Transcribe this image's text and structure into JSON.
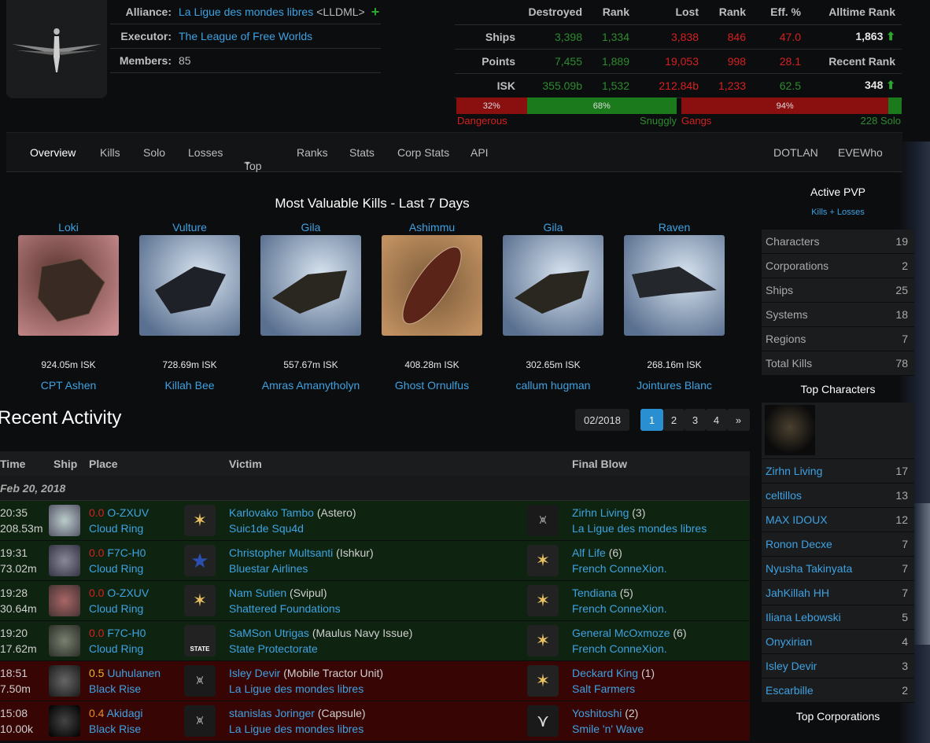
{
  "alliance_info": {
    "alliance_label": "Alliance:",
    "alliance_name": "La Ligue des mondes libres",
    "alliance_ticker": "<LLDML>",
    "executor_label": "Executor:",
    "executor_name": "The League of Free Worlds",
    "members_label": "Members:",
    "members_value": "85"
  },
  "stats": {
    "headers": [
      "Destroyed",
      "Rank",
      "Lost",
      "Rank",
      "Eff. %",
      "Alltime Rank"
    ],
    "ships": {
      "label": "Ships",
      "destroyed": "3,398",
      "destroyed_rank": "1,334",
      "lost": "3,838",
      "lost_rank": "846",
      "eff": "47.0",
      "extra": "1,863"
    },
    "points": {
      "label": "Points",
      "destroyed": "7,455",
      "destroyed_rank": "1,889",
      "lost": "19,053",
      "lost_rank": "998",
      "eff": "28.1",
      "extra": "Recent Rank"
    },
    "isk": {
      "label": "ISK",
      "destroyed": "355.09b",
      "destroyed_rank": "1,532",
      "lost": "212.84b",
      "lost_rank": "1,233",
      "eff": "62.5",
      "extra": "348"
    }
  },
  "bars": {
    "dangerous_pct_label": "32%",
    "dangerous_pct": 32,
    "snuggly_pct_label": "68%",
    "snuggly_pct": 68,
    "dangerous_label": "Dangerous",
    "snuggly_label": "Snuggly",
    "gangs_pct_label": "94%",
    "gangs_pct": 94,
    "gangs_label": "Gangs",
    "solo_label": "228 Solo"
  },
  "nav": {
    "overview": "Overview",
    "kills": "Kills",
    "solo": "Solo",
    "losses": "Losses",
    "top": "Top",
    "ranks": "Ranks",
    "stats": "Stats",
    "corp_stats": "Corp Stats",
    "api": "API",
    "dotlan": "DOTLAN",
    "evewho": "EVEWho"
  },
  "valuable": {
    "title": "Most Valuable Kills - Last 7 Days",
    "items": [
      {
        "ship": "Loki",
        "isk": "924.05m ISK",
        "killer": "CPT Ashen"
      },
      {
        "ship": "Vulture",
        "isk": "728.69m ISK",
        "killer": "Killah Bee"
      },
      {
        "ship": "Gila",
        "isk": "557.67m ISK",
        "killer": "Amras Amanytholyn"
      },
      {
        "ship": "Ashimmu",
        "isk": "408.28m ISK",
        "killer": "Ghost Ornulfus"
      },
      {
        "ship": "Gila",
        "isk": "302.65m ISK",
        "killer": "callum hugman"
      },
      {
        "ship": "Raven",
        "isk": "268.16m ISK",
        "killer": "Jointures Blanc"
      }
    ]
  },
  "side": {
    "active_pvp": "Active PVP",
    "kills_losses": "Kills + Losses",
    "rows": [
      {
        "label": "Characters",
        "value": "19"
      },
      {
        "label": "Corporations",
        "value": "2"
      },
      {
        "label": "Ships",
        "value": "25"
      },
      {
        "label": "Systems",
        "value": "18"
      },
      {
        "label": "Regions",
        "value": "7"
      },
      {
        "label": "Total Kills",
        "value": "78"
      }
    ],
    "top_characters": "Top Characters",
    "chars": [
      {
        "name": "Zirhn Living",
        "value": "17"
      },
      {
        "name": "celtillos",
        "value": "13"
      },
      {
        "name": "MAX IDOUX",
        "value": "12"
      },
      {
        "name": "Ronon Decxe",
        "value": "7"
      },
      {
        "name": "Nyusha Takinyata",
        "value": "7"
      },
      {
        "name": "JahKillah HH",
        "value": "7"
      },
      {
        "name": "Iliana Lebowski",
        "value": "5"
      },
      {
        "name": "Onyxirian",
        "value": "4"
      },
      {
        "name": "Isley Devir",
        "value": "3"
      },
      {
        "name": "Escarbille",
        "value": "2"
      }
    ],
    "top_corporations": "Top Corporations"
  },
  "recent": {
    "title": "Recent Activity",
    "month": "02/2018",
    "pages": [
      "1",
      "2",
      "3",
      "4",
      "»"
    ],
    "headers": {
      "time": "Time",
      "ship": "Ship",
      "place": "Place",
      "victim": "Victim",
      "final_blow": "Final Blow"
    },
    "date": "Feb 20, 2018",
    "rows": [
      {
        "kind": "ok",
        "time": "20:35",
        "value": "208.53m",
        "sec": "0.0",
        "system": "O-ZXUV",
        "region": "Cloud Ring",
        "victim": "Karlovako Tambo",
        "victim_ship": "(Astero)",
        "victim_group": "Suic1de Squ4d",
        "fb_name": "Zirhn Living",
        "fb_count": "(3)",
        "fb_group": "La Ligue des mondes libres"
      },
      {
        "kind": "ok",
        "time": "19:31",
        "value": "73.02m",
        "sec": "0.0",
        "system": "F7C-H0",
        "region": "Cloud Ring",
        "victim": "Christopher Multsanti",
        "victim_ship": "(Ishkur)",
        "victim_group": "Bluestar Airlines",
        "fb_name": "Alf Life",
        "fb_count": "(6)",
        "fb_group": "French ConneXion."
      },
      {
        "kind": "ok",
        "time": "19:28",
        "value": "30.64m",
        "sec": "0.0",
        "system": "O-ZXUV",
        "region": "Cloud Ring",
        "victim": "Nam Sutien",
        "victim_ship": "(Svipul)",
        "victim_group": "Shattered Foundations",
        "fb_name": "Tendiana",
        "fb_count": "(5)",
        "fb_group": "French ConneXion."
      },
      {
        "kind": "ok",
        "time": "19:20",
        "value": "17.62m",
        "sec": "0.0",
        "system": "F7C-H0",
        "region": "Cloud Ring",
        "victim": "SaMSon Utrigas",
        "victim_ship": "(Maulus Navy Issue)",
        "victim_group": "State Protectorate",
        "fb_name": "General McOxmoze",
        "fb_count": "(6)",
        "fb_group": "French ConneXion."
      },
      {
        "kind": "bad",
        "time": "18:51",
        "value": "7.50m",
        "sec": "0.5",
        "system": "Uuhulanen",
        "region": "Black Rise",
        "victim": "Isley Devir",
        "victim_ship": "(Mobile Tractor Unit)",
        "victim_group": "La Ligue des mondes libres",
        "fb_name": "Deckard King",
        "fb_count": "(1)",
        "fb_group": "Salt Farmers"
      },
      {
        "kind": "bad",
        "time": "15:08",
        "value": "10.00k",
        "sec": "0.4",
        "system": "Akidagi",
        "region": "Black Rise",
        "victim": "stanislas Joringer",
        "victim_ship": "(Capsule)",
        "victim_group": "La Ligue des mondes libres",
        "fb_name": "Yoshitoshi",
        "fb_count": "(2)",
        "fb_group": "Smile 'n' Wave"
      }
    ]
  },
  "colors": {
    "link": "#3ea2e2",
    "green": "#2e8b2e",
    "red": "#d62020",
    "ok_row": "#0e2410",
    "bad_row": "#380505"
  }
}
